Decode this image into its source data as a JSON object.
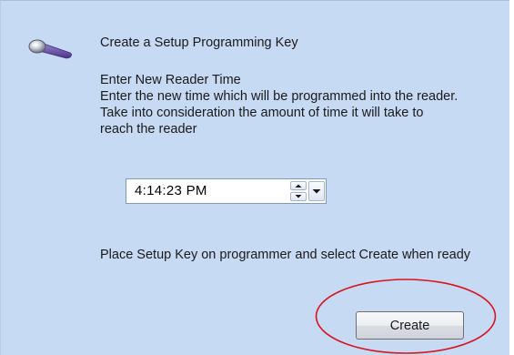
{
  "wizard": {
    "title": "Create a Setup Programming Key",
    "heading": "Enter New Reader Time",
    "description": "Enter the new time which will be programmed into the reader. Take into consideration the amount of time it will take to reach the reader",
    "time_value": "4:14:23 PM",
    "instruction": "Place Setup Key on programmer and select Create when ready",
    "create_label": "Create"
  },
  "icons": {
    "key": "key-icon",
    "spin_up": "chevron-up-icon",
    "spin_down": "chevron-down-icon",
    "dropdown": "dropdown-arrow-icon"
  },
  "colors": {
    "panel_background": "#c6daf4",
    "annotation_circle": "#d9141c",
    "key_handle": "#6a4fa3"
  }
}
